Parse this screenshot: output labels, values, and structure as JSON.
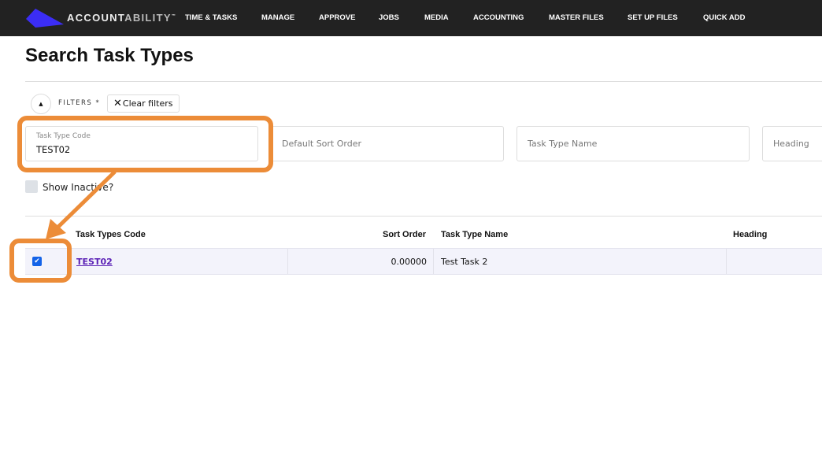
{
  "nav": {
    "brand_bold": "ACCOUNT",
    "brand_light": "ABILITY",
    "brand_tm": "™",
    "items": [
      "TIME & TASKS",
      "MANAGE",
      "APPROVE",
      "JOBS",
      "MEDIA",
      "ACCOUNTING",
      "MASTER FILES",
      "SET UP FILES",
      "QUICK ADD"
    ],
    "logo_color": "#3b2df5"
  },
  "page": {
    "title": "Search Task Types"
  },
  "filters": {
    "label": "FILTERS *",
    "clear": "Clear filters",
    "task_type_code_label": "Task Type Code",
    "task_type_code_value": "TEST02",
    "default_sort_order": "Default Sort Order",
    "task_type_name": "Task Type Name",
    "heading": "Heading",
    "show_inactive": "Show Inactive?"
  },
  "table": {
    "headers": [
      "Task Types Code",
      "Sort Order",
      "Task Type Name",
      "Heading"
    ],
    "rows": [
      {
        "code": "TEST02",
        "sort_order": "0.00000",
        "name": "Test Task 2",
        "heading": "",
        "selected": true
      }
    ]
  },
  "annotation_color": "#ec8c38"
}
